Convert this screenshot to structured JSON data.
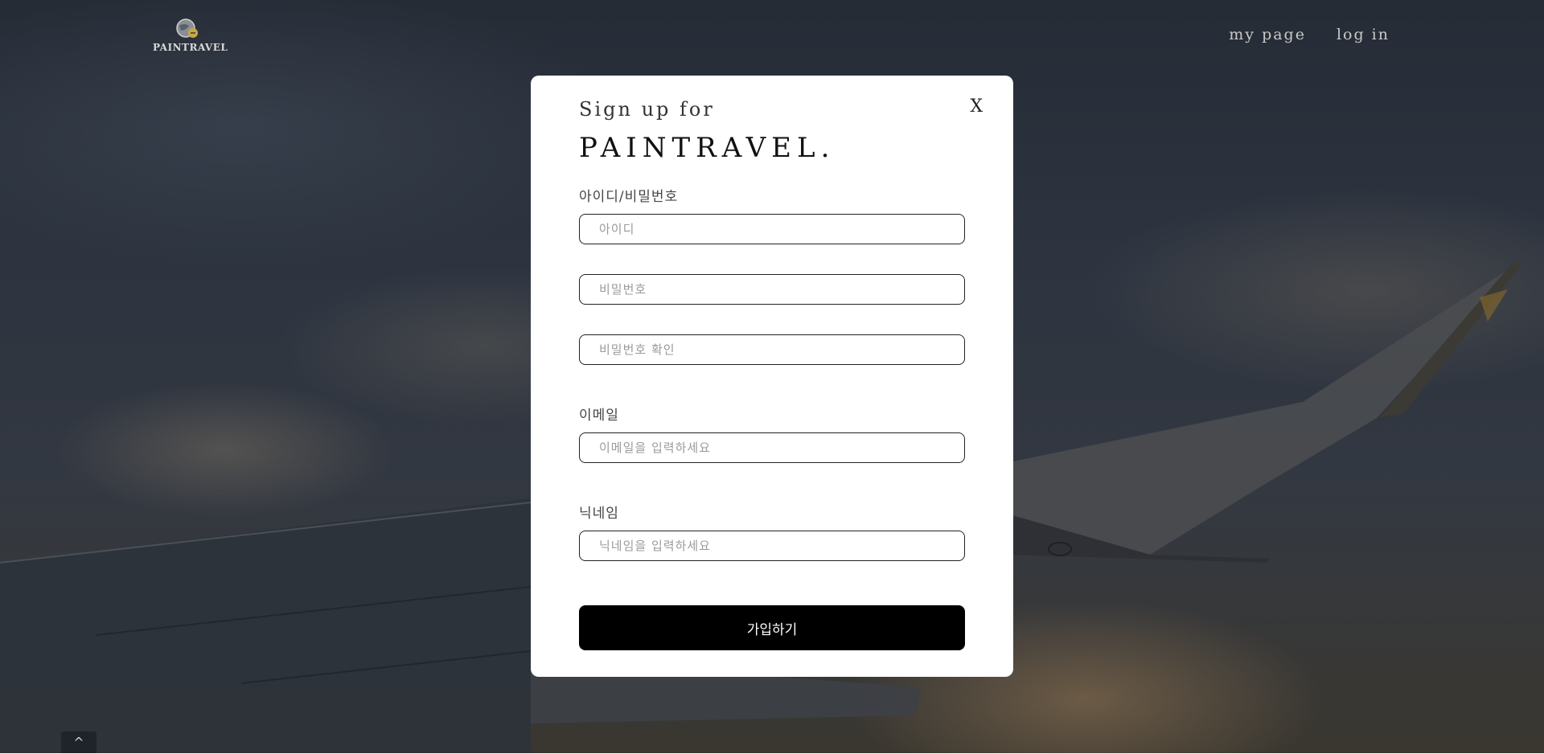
{
  "header": {
    "logo_text": "PAINTRAVEL",
    "nav": {
      "my_page": "my page",
      "log_in": "log in"
    }
  },
  "scroll_top": {
    "icon": "chevron-up-icon",
    "glyph": "^"
  },
  "modal": {
    "close_label": "X",
    "subtitle": "Sign up for",
    "title": "PAINTRAVEL.",
    "id_password_label": "아이디/비밀번호",
    "id_placeholder": "아이디",
    "password_placeholder": "비밀번호",
    "password_confirm_placeholder": "비밀번호 확인",
    "email_label": "이메일",
    "email_placeholder": "이메일을 입력하세요",
    "nickname_label": "닉네임",
    "nickname_placeholder": "닉네임을 입력하세요",
    "submit_label": "가입하기"
  },
  "colors": {
    "overlay": "#2b313b",
    "modal_bg": "#ffffff",
    "submit_bg": "#000000",
    "nav_text": "#c9c9c9"
  }
}
